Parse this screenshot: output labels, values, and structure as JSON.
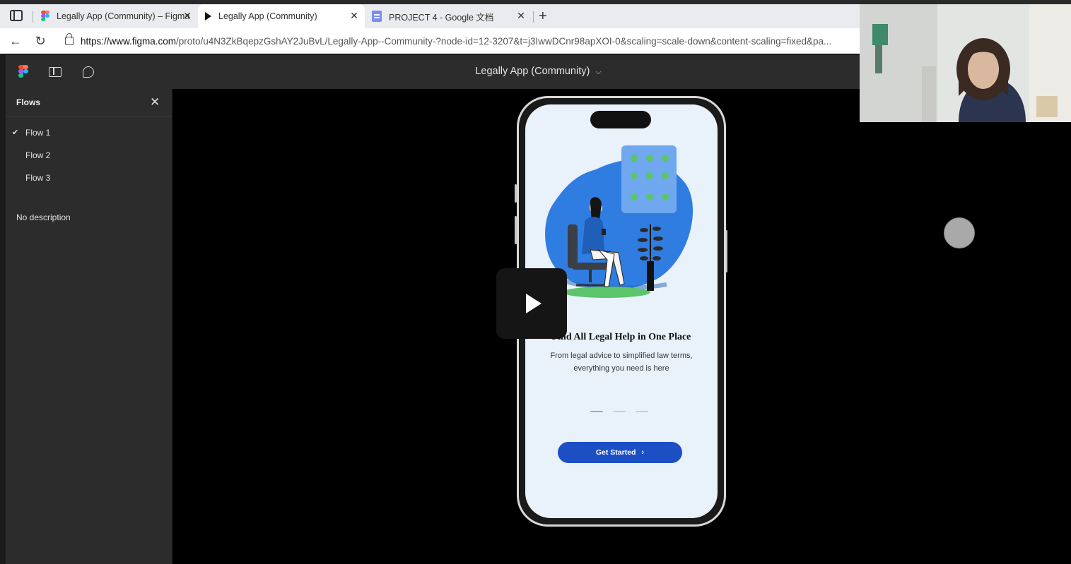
{
  "browser": {
    "tabs": [
      {
        "label": "Legally App (Community) – Figma",
        "icon": "figma-logo-icon",
        "active": false
      },
      {
        "label": "Legally App (Community)",
        "icon": "play-icon",
        "active": true
      },
      {
        "label": "PROJECT 4 - Google 文档",
        "icon": "google-docs-icon",
        "active": false
      }
    ],
    "new_tab": "+",
    "url_host": "https://www.figma.com",
    "url_rest": "/proto/u4N3ZkBqepzGshAY2JuBvL/Legally-App--Community-?node-id=12-3207&t=j3IwwDCnr98apXOI-0&scaling=scale-down&content-scaling=fixed&pa..."
  },
  "figma": {
    "title": "Legally App (Community)",
    "flows_heading": "Flows",
    "flows": [
      "Flow 1",
      "Flow 2",
      "Flow 3"
    ],
    "selected_flow": "Flow 1",
    "description": "No description"
  },
  "screen": {
    "title_prefix": "Find",
    "title_rest": " All Legal Help in One Place",
    "subtitle_line1": "From legal advice to simplified law terms,",
    "subtitle_line2": "everything you need is here",
    "button_label": "Get Started",
    "button_arrow": "›",
    "pagination_active_index": 0,
    "pagination_count": 3
  },
  "colors": {
    "accent_blue": "#1d4fc4",
    "illustration_blue": "#2f7de1",
    "green": "#5cc46a",
    "dark_ui": "#2c2c2c"
  }
}
